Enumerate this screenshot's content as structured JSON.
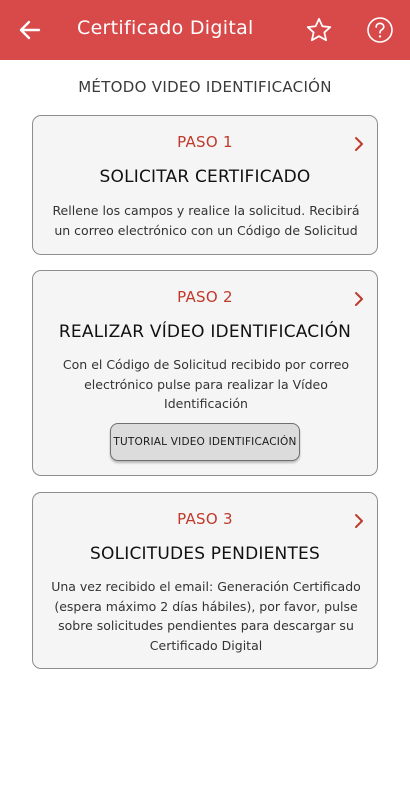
{
  "appbar": {
    "title": "Certificado Digital",
    "back_icon": "arrow-left-icon",
    "favorite_icon": "star-outline-icon",
    "help_icon": "question-circle-icon",
    "color": "#d84a4a"
  },
  "section_title": "MÉTODO VIDEO IDENTIFICACIÓN",
  "accent_color": "#c0392b",
  "steps": [
    {
      "label": "PASO 1",
      "title": "SOLICITAR CERTIFICADO",
      "description_lines": [
        "Rellene los campos y realice la solicitud. Recibirá",
        "un correo electrónico con un Código de Solicitud"
      ]
    },
    {
      "label": "PASO 2",
      "title": "REALIZAR VÍDEO IDENTIFICACIÓN",
      "description_lines": [
        "Con el Código de Solicitud recibido por correo",
        "electrónico pulse para realizar la Vídeo",
        "Identificación"
      ],
      "button_label": "TUTORIAL VIDEO IDENTIFICACIÓN"
    },
    {
      "label": "PASO 3",
      "title": "SOLICITUDES PENDIENTES",
      "description_lines": [
        "Una vez recibido el email: Generación Certificado",
        "(espera máximo 2 días hábiles), por favor, pulse",
        "sobre solicitudes pendientes para descargar su",
        "Certificado Digital"
      ]
    }
  ]
}
